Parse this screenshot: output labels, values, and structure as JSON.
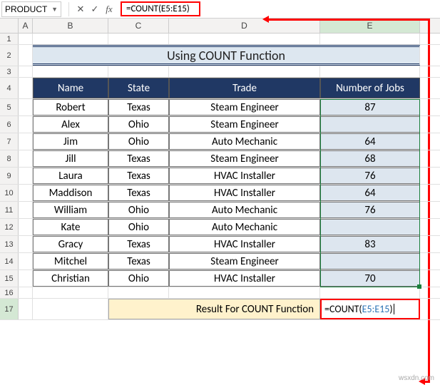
{
  "name_box": "PRODUCT",
  "formula_bar": "=COUNT(E5:E15)",
  "columns": [
    "A",
    "B",
    "C",
    "D",
    "E"
  ],
  "row_numbers": [
    "1",
    "2",
    "3",
    "4",
    "5",
    "6",
    "7",
    "8",
    "9",
    "10",
    "11",
    "12",
    "13",
    "14",
    "15",
    "16",
    "17"
  ],
  "title": "Using COUNT Function",
  "headers": {
    "b": "Name",
    "c": "State",
    "d": "Trade",
    "e": "Number of Jobs"
  },
  "rows": [
    {
      "b": "Robert",
      "c": "Texas",
      "d": "Steam Engineer",
      "e": "87"
    },
    {
      "b": "Alex",
      "c": "Ohio",
      "d": "Steam Engineer",
      "e": ""
    },
    {
      "b": "Jim",
      "c": "Ohio",
      "d": "Auto Mechanic",
      "e": "64"
    },
    {
      "b": "Jill",
      "c": "Texas",
      "d": "Steam Engineer",
      "e": "68"
    },
    {
      "b": "Laura",
      "c": "Texas",
      "d": "HVAC Installer",
      "e": "76"
    },
    {
      "b": "Maddison",
      "c": "Texas",
      "d": "HVAC Installer",
      "e": "64"
    },
    {
      "b": "William",
      "c": "Ohio",
      "d": "Auto Mechanic",
      "e": "76"
    },
    {
      "b": "Kate",
      "c": "Ohio",
      "d": "Auto Mechanic",
      "e": ""
    },
    {
      "b": "Gracy",
      "c": "Texas",
      "d": "HVAC Installer",
      "e": "83"
    },
    {
      "b": "Mitchel",
      "c": "Texas",
      "d": "Steam Engineer",
      "e": ""
    },
    {
      "b": "Christian",
      "c": "Ohio",
      "d": "HVAC Installer",
      "e": "70"
    }
  ],
  "result_label": "Result For COUNT Function",
  "result_formula_prefix": "=COUNT(",
  "result_formula_ref": "E5:E15",
  "result_formula_suffix": ")",
  "watermark": "wsxdn.com",
  "chart_data": {
    "type": "table",
    "title": "Using COUNT Function",
    "columns": [
      "Name",
      "State",
      "Trade",
      "Number of Jobs"
    ],
    "rows": [
      [
        "Robert",
        "Texas",
        "Steam Engineer",
        87
      ],
      [
        "Alex",
        "Ohio",
        "Steam Engineer",
        null
      ],
      [
        "Jim",
        "Ohio",
        "Auto Mechanic",
        64
      ],
      [
        "Jill",
        "Texas",
        "Steam Engineer",
        68
      ],
      [
        "Laura",
        "Texas",
        "HVAC Installer",
        76
      ],
      [
        "Maddison",
        "Texas",
        "HVAC Installer",
        64
      ],
      [
        "William",
        "Ohio",
        "Auto Mechanic",
        76
      ],
      [
        "Kate",
        "Ohio",
        "Auto Mechanic",
        null
      ],
      [
        "Gracy",
        "Texas",
        "HVAC Installer",
        83
      ],
      [
        "Mitchel",
        "Texas",
        "Steam Engineer",
        null
      ],
      [
        "Christian",
        "Ohio",
        "HVAC Installer",
        70
      ]
    ]
  }
}
